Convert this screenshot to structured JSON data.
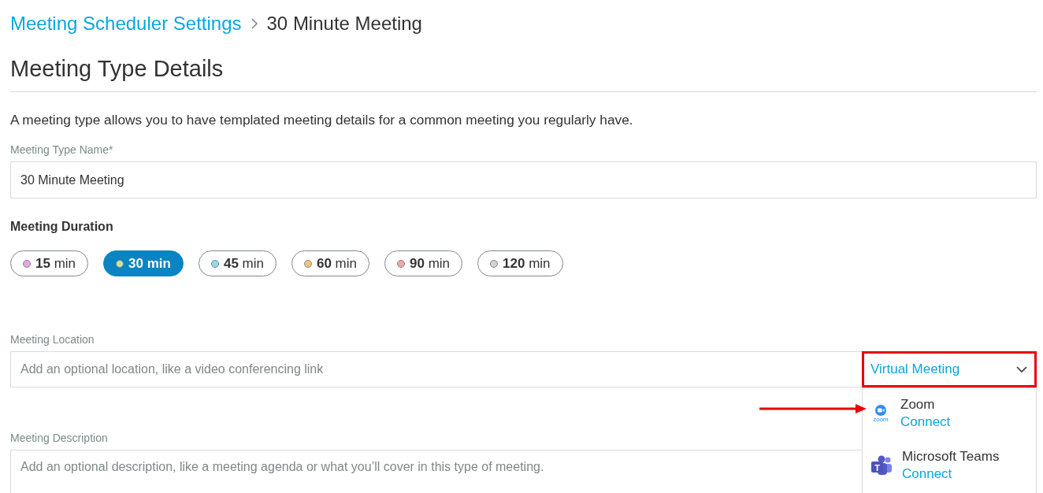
{
  "breadcrumb": {
    "items": [
      {
        "label": "Meeting Scheduler Settings",
        "kind": "link"
      },
      {
        "label": "30 Minute Meeting",
        "kind": "current"
      }
    ]
  },
  "section": {
    "title": "Meeting Type Details",
    "intro": "A meeting type allows you to have templated meeting details for a common meeting you regularly have."
  },
  "name_field": {
    "label": "Meeting Type Name*",
    "value": "30 Minute Meeting"
  },
  "duration": {
    "label": "Meeting Duration",
    "options": [
      {
        "label": "**15** min",
        "color": "#eaa6e4",
        "selected": false
      },
      {
        "label": "**30** min",
        "color": "#c9e4a2",
        "selected": true
      },
      {
        "label": "**45** min",
        "color": "#94d9ee",
        "selected": false
      },
      {
        "label": "**60** min",
        "color": "#f6c37e",
        "selected": false
      },
      {
        "label": "**90** min",
        "color": "#f4a59d",
        "selected": false
      },
      {
        "label": "**120** min",
        "color": "#d3d3d3",
        "selected": false
      }
    ]
  },
  "location": {
    "label": "Meeting Location",
    "placeholder": "Add an optional location, like a video conferencing link",
    "type_select": {
      "value": "Virtual Meeting",
      "highlighted": true,
      "expanded": true
    },
    "menu": [
      {
        "name": "Zoom",
        "action": "Connect",
        "kind": "camera",
        "logo_text": "zoom",
        "pointed": true
      },
      {
        "name": "Microsoft Teams",
        "action": "Connect",
        "kind": "tile",
        "logo_text": "T",
        "pointed": false
      }
    ]
  },
  "description": {
    "label": "Meeting Description",
    "placeholder": "Add an optional description, like a meeting agenda or what you’ll cover in this type of meeting."
  }
}
